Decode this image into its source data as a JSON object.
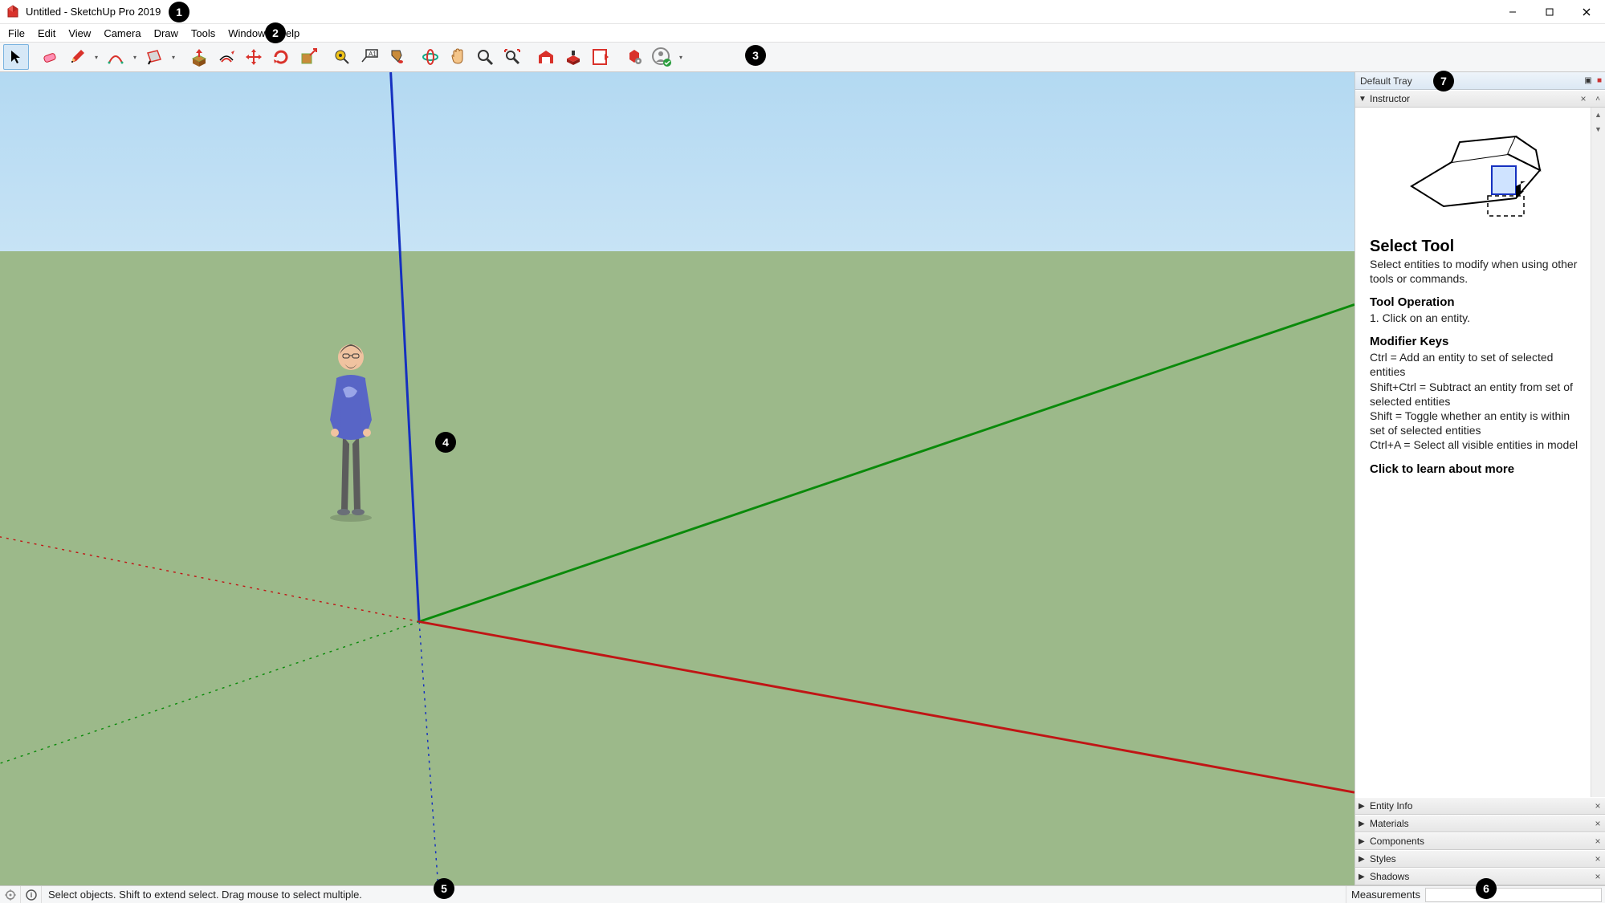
{
  "titlebar": {
    "title": "Untitled - SketchUp Pro 2019"
  },
  "menubar": [
    "File",
    "Edit",
    "View",
    "Camera",
    "Draw",
    "Tools",
    "Window",
    "Help"
  ],
  "toolbar_tools": [
    {
      "name": "select",
      "selected": true,
      "dd": false
    },
    {
      "name": "eraser",
      "dd": false
    },
    {
      "name": "pencil",
      "dd": true
    },
    {
      "name": "arc",
      "dd": true
    },
    {
      "name": "rectangle",
      "dd": true
    },
    {
      "name": "sep"
    },
    {
      "name": "pushpull",
      "dd": false
    },
    {
      "name": "offset",
      "dd": false
    },
    {
      "name": "move",
      "dd": false
    },
    {
      "name": "rotate",
      "dd": false
    },
    {
      "name": "scale",
      "dd": false
    },
    {
      "name": "sep"
    },
    {
      "name": "tape",
      "dd": false
    },
    {
      "name": "text",
      "dd": false
    },
    {
      "name": "paint",
      "dd": false
    },
    {
      "name": "sep"
    },
    {
      "name": "orbit",
      "dd": false
    },
    {
      "name": "pan",
      "dd": false
    },
    {
      "name": "zoom",
      "dd": false
    },
    {
      "name": "zoom-extents",
      "dd": false
    },
    {
      "name": "sep"
    },
    {
      "name": "warehouse",
      "dd": false
    },
    {
      "name": "components",
      "dd": false
    },
    {
      "name": "layout",
      "dd": false
    },
    {
      "name": "sep"
    },
    {
      "name": "extension",
      "dd": false
    },
    {
      "name": "signin",
      "dd": true
    }
  ],
  "tray": {
    "title": "Default Tray",
    "panels": [
      {
        "label": "Instructor",
        "open": true
      },
      {
        "label": "Entity Info",
        "open": false
      },
      {
        "label": "Materials",
        "open": false
      },
      {
        "label": "Components",
        "open": false
      },
      {
        "label": "Styles",
        "open": false
      },
      {
        "label": "Shadows",
        "open": false
      }
    ]
  },
  "instructor": {
    "tool_title": "Select Tool",
    "tool_desc": "Select entities to modify when using other tools or commands.",
    "op_title": "Tool Operation",
    "op_body": "1. Click on an entity.",
    "mod_title": "Modifier Keys",
    "mod_body": "Ctrl = Add an entity to set of selected entities\nShift+Ctrl = Subtract an entity from set of selected entities\nShift = Toggle whether an entity is within set of selected entities\nCtrl+A = Select all visible entities in model",
    "learn_more": "Click to learn about more"
  },
  "statusbar": {
    "hint": "Select objects. Shift to extend select. Drag mouse to select multiple.",
    "meas_label": "Measurements",
    "meas_value": ""
  },
  "callouts": [
    "1",
    "2",
    "3",
    "4",
    "5",
    "6",
    "7"
  ]
}
